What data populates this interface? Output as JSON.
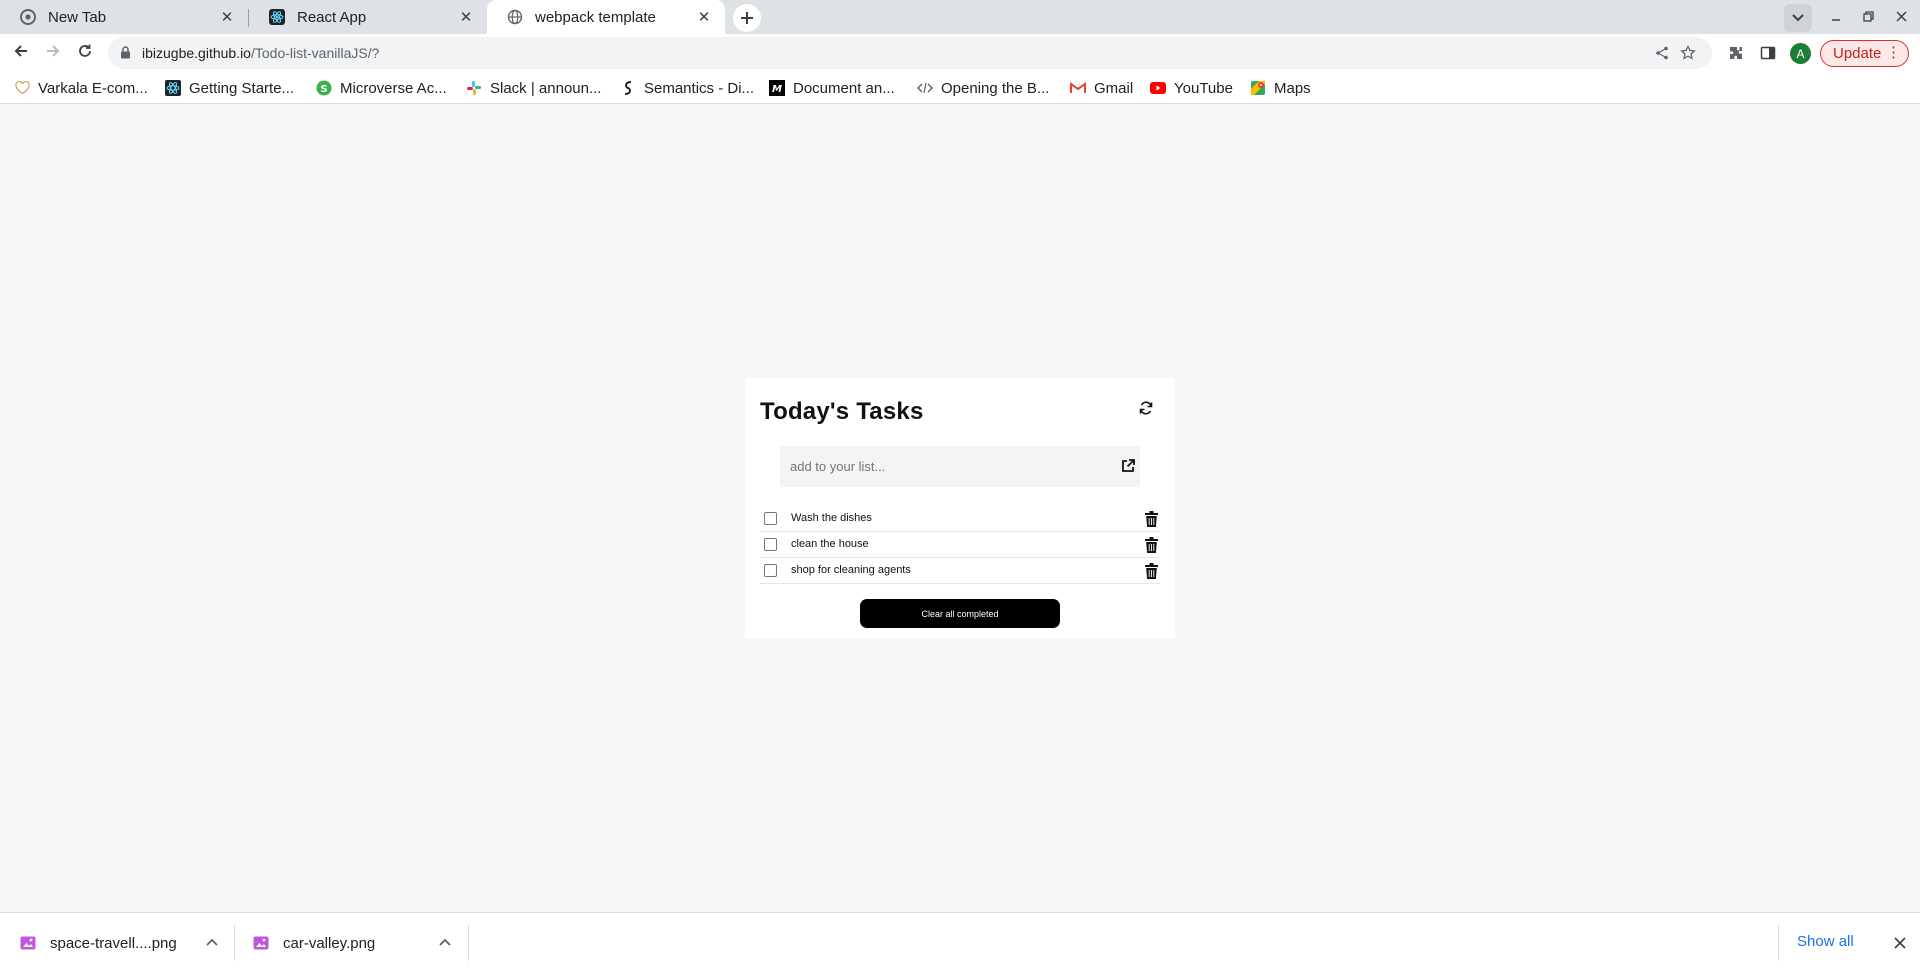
{
  "browser": {
    "tabs": [
      {
        "title": "New Tab",
        "icon": "chrome-icon"
      },
      {
        "title": "React App",
        "icon": "react-icon"
      },
      {
        "title": "webpack template",
        "icon": "globe-icon",
        "active": true
      }
    ],
    "url_host": "ibizugbe.github.io",
    "url_path": "/Todo-list-vanillaJS/?",
    "profile_initial": "A",
    "update_label": "Update",
    "bookmarks": [
      {
        "label": "Varkala E-com...",
        "icon": "heart-icon"
      },
      {
        "label": "Getting Starte...",
        "icon": "react-icon"
      },
      {
        "label": "Microverse Ac...",
        "icon": "microverse-icon"
      },
      {
        "label": "Slack | announ...",
        "icon": "slack-icon"
      },
      {
        "label": "Semantics - Di...",
        "icon": "semantics-icon"
      },
      {
        "label": "Document an...",
        "icon": "medium-icon"
      },
      {
        "label": "Opening the B...",
        "icon": "code-icon"
      },
      {
        "label": "Gmail",
        "icon": "gmail-icon"
      },
      {
        "label": "YouTube",
        "icon": "youtube-icon"
      },
      {
        "label": "Maps",
        "icon": "maps-icon"
      }
    ]
  },
  "app": {
    "title": "Today's Tasks",
    "input_placeholder": "add to your list...",
    "tasks": [
      {
        "label": "Wash the dishes",
        "completed": false
      },
      {
        "label": "clean the house",
        "completed": false
      },
      {
        "label": "shop for cleaning agents",
        "completed": false
      }
    ],
    "clear_label": "Clear all completed"
  },
  "downloads": {
    "items": [
      {
        "name": "space-travell....png"
      },
      {
        "name": "car-valley.png"
      }
    ],
    "show_all_label": "Show all"
  },
  "colors": {
    "page_bg": "#f7f7f7",
    "card_bg": "#ffffff",
    "button_bg": "#000000",
    "update_accent": "#d93025",
    "link_blue": "#1a73e8"
  }
}
